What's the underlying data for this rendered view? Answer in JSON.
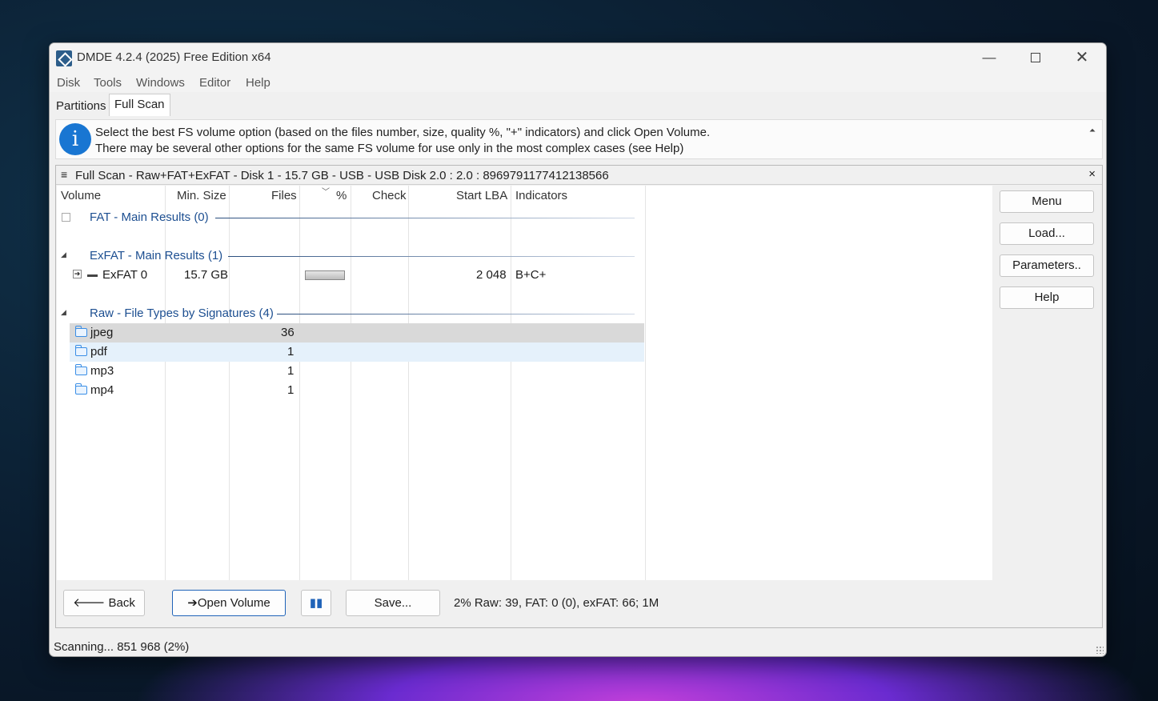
{
  "window": {
    "title": "DMDE 4.2.4 (2025) Free Edition x64",
    "controls": {
      "minimize": "—",
      "close": "✕"
    }
  },
  "menu": [
    "Disk",
    "Tools",
    "Windows",
    "Editor",
    "Help"
  ],
  "tabs": [
    {
      "label": "Partitions",
      "active": false
    },
    {
      "label": "Full Scan",
      "active": true
    }
  ],
  "info": {
    "icon": "i",
    "line1": "Select the best FS volume option (based on the files number, size, quality %, \"+\" indicators) and click Open Volume.",
    "line2": "There may be several other options for the same FS volume for use only in the most complex cases (see Help)"
  },
  "panel": {
    "title": "Full Scan - Raw+FAT+ExFAT - Disk 1 - 15.7 GB - USB - USB Disk 2.0 : 2.0 : 8969791177412138566",
    "hamburger": "≡",
    "close": "×"
  },
  "columns": {
    "volume": "Volume",
    "min_size": "Min. Size",
    "files": "Files",
    "percent": "%",
    "check": "Check",
    "start_lba": "Start LBA",
    "indicators": "Indicators"
  },
  "groups": {
    "fat": {
      "title": "FAT - Main Results (0)"
    },
    "exfat": {
      "title": "ExFAT - Main Results (1)",
      "item": {
        "name": "ExFAT 0",
        "min_size": "15.7 GB",
        "start_lba": "2 048",
        "indicators": "B+C+"
      }
    },
    "raw": {
      "title": "Raw - File Types by Signatures (4)",
      "items": [
        {
          "name": "jpeg",
          "files": "36"
        },
        {
          "name": "pdf",
          "files": "1"
        },
        {
          "name": "mp3",
          "files": "1"
        },
        {
          "name": "mp4",
          "files": "1"
        }
      ]
    }
  },
  "side_buttons": [
    "Menu",
    "Load...",
    "Parameters..",
    "Help"
  ],
  "bottom": {
    "back": "🡐 Back",
    "open_volume": "Open Volume",
    "save": "Save...",
    "scan_stats": "2% Raw: 39, FAT: 0 (0), exFAT: 66; 1M"
  },
  "status": "Scanning... 851 968 (2%)"
}
